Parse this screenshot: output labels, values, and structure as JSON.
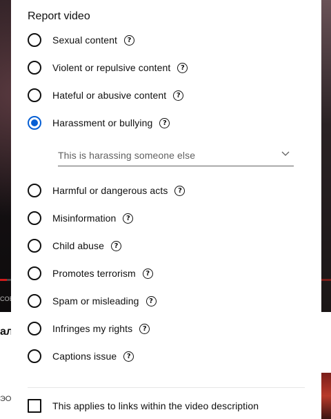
{
  "background": {
    "left_caption": "СОВ",
    "title_fragment": "ал",
    "bottom_fragment": "ЭО"
  },
  "dialog": {
    "title": "Report video",
    "options": [
      {
        "label": "Sexual content",
        "help_icon": "question-circle-icon",
        "selected": false
      },
      {
        "label": "Violent or repulsive content",
        "help_icon": "question-circle-icon",
        "selected": false
      },
      {
        "label": "Hateful or abusive content",
        "help_icon": "question-circle-icon",
        "selected": false
      },
      {
        "label": "Harassment or bullying",
        "help_icon": "question-circle-icon",
        "selected": true
      },
      {
        "label": "Harmful or dangerous acts",
        "help_icon": "question-circle-icon",
        "selected": false
      },
      {
        "label": "Misinformation",
        "help_icon": "question-circle-icon",
        "selected": false
      },
      {
        "label": "Child abuse",
        "help_icon": "question-circle-icon",
        "selected": false
      },
      {
        "label": "Promotes terrorism",
        "help_icon": "question-circle-icon",
        "selected": false
      },
      {
        "label": "Spam or misleading",
        "help_icon": "question-circle-icon",
        "selected": false
      },
      {
        "label": "Infringes my rights",
        "help_icon": "question-circle-icon",
        "selected": false
      },
      {
        "label": "Captions issue",
        "help_icon": "question-circle-icon",
        "selected": false
      }
    ],
    "help_glyph": "?",
    "sub_select": {
      "value": "This is harassing someone else",
      "icon": "chevron-down-icon"
    },
    "links_checkbox": {
      "label": "This applies to links within the video description",
      "checked": false
    },
    "colors": {
      "accent": "#065fd4",
      "text": "#0f0f0f",
      "secondary_text": "#606060",
      "divider": "#e5e5e5"
    }
  }
}
